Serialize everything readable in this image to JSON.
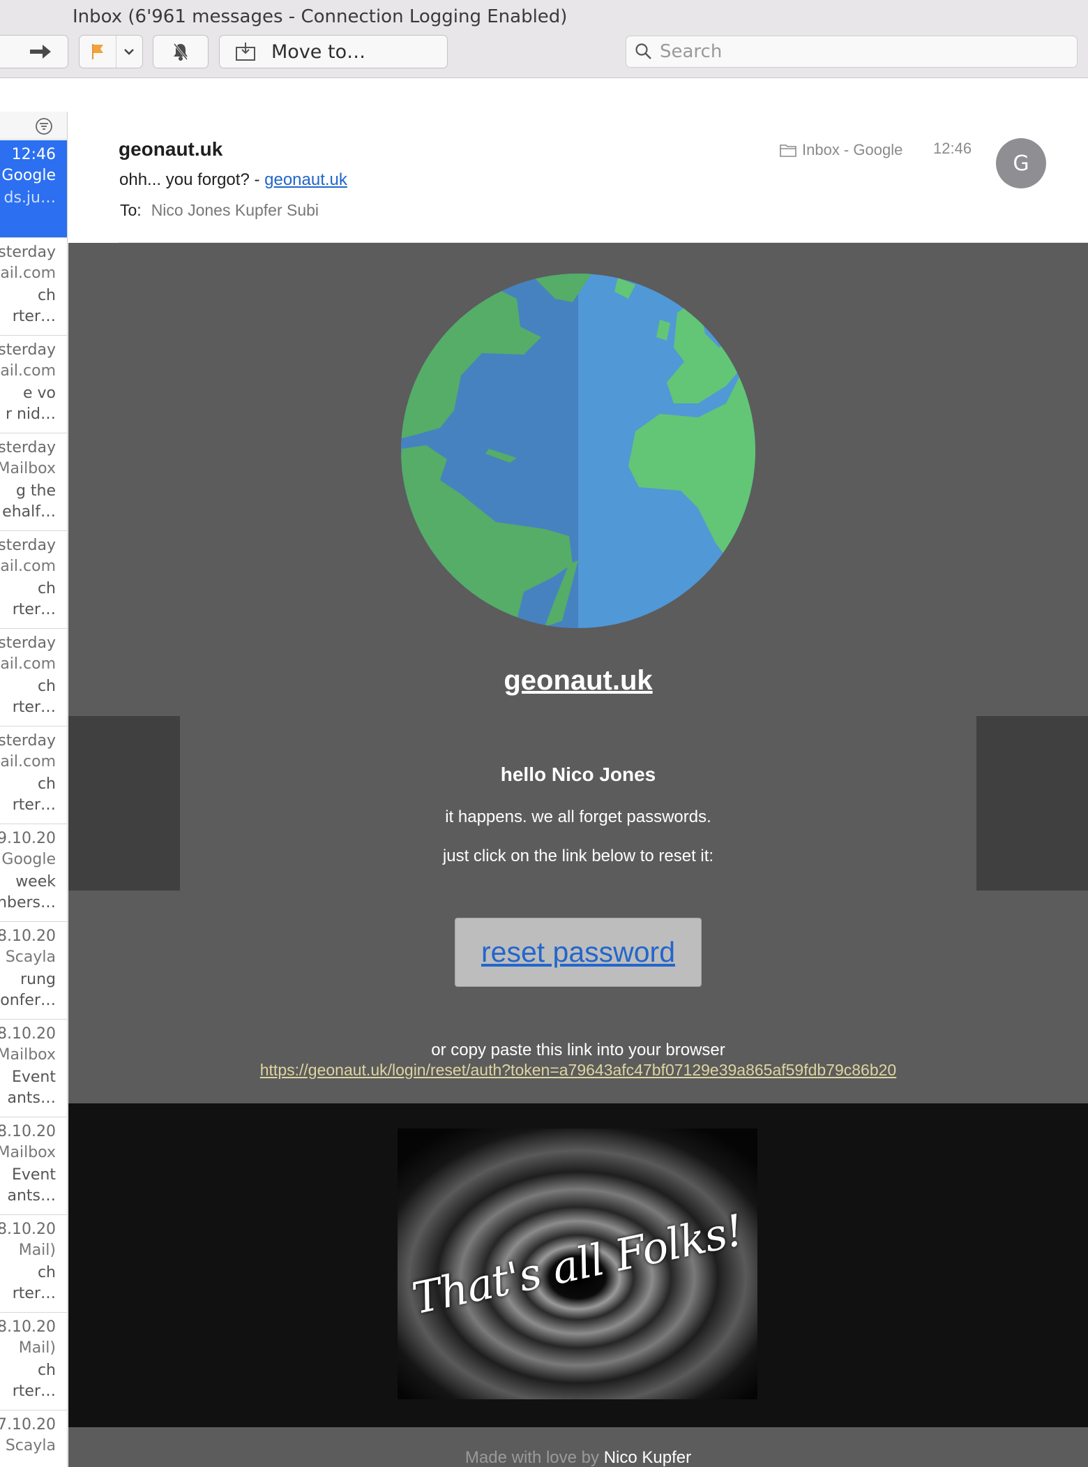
{
  "window": {
    "title": "Inbox (6'961 messages - Connection Logging Enabled)"
  },
  "toolbar": {
    "move_label": "Move to…"
  },
  "search": {
    "placeholder": "Search"
  },
  "message_list": {
    "items": [
      {
        "l1": "12:46",
        "l2": "Google",
        "l3": "ds.ju…",
        "l4": "",
        "selected": true
      },
      {
        "l1": "sterday",
        "l2": "ail.com",
        "l3": "ch",
        "l4": "rter…"
      },
      {
        "l1": "sterday",
        "l2": "ail.com",
        "l3": "e vo",
        "l4": "r nid…"
      },
      {
        "l1": "sterday",
        "l2": "Mailbox",
        "l3": "g the",
        "l4": "ehalf…"
      },
      {
        "l1": "sterday",
        "l2": "ail.com",
        "l3": "ch",
        "l4": "rter…"
      },
      {
        "l1": "sterday",
        "l2": "ail.com",
        "l3": "ch",
        "l4": "rter…"
      },
      {
        "l1": "sterday",
        "l2": "ail.com",
        "l3": "ch",
        "l4": "rter…"
      },
      {
        "l1": "9.10.20",
        "l2": "Google",
        "l3": "week",
        "l4": "nbers…"
      },
      {
        "l1": "8.10.20",
        "l2": "- Scayla",
        "l3": "rung",
        "l4": "onfer…"
      },
      {
        "l1": "8.10.20",
        "l2": "Mailbox",
        "l3": "Event",
        "l4": "ants…"
      },
      {
        "l1": "8.10.20",
        "l2": "Mailbox",
        "l3": "Event",
        "l4": "ants…"
      },
      {
        "l1": "8.10.20",
        "l2": "Mail)",
        "l3": "ch",
        "l4": "rter…"
      },
      {
        "l1": "8.10.20",
        "l2": "Mail)",
        "l3": "ch",
        "l4": "rter…"
      },
      {
        "l1": "7.10.20",
        "l2": "- Scayla",
        "l3": "",
        "l4": ""
      }
    ]
  },
  "message": {
    "from": "geonaut.uk",
    "subject_prefix": "ohh... you forgot? - ",
    "subject_link": "geonaut.uk",
    "to_label": "To:",
    "to_value": "Nico Jones Kupfer Subi",
    "mailbox": "Inbox - Google",
    "time": "12:46",
    "avatar_letter": "G"
  },
  "body": {
    "brand": "geonaut.uk",
    "greeting": "hello Nico Jones",
    "line1": "it happens. we all forget passwords.",
    "line2": "just click on the link below to reset it:",
    "button": "reset password",
    "copy_text": "or copy paste this link into your browser",
    "url": "https://geonaut.uk/login/reset/auth?token=a79643afc47bf07129e39a865af59fdb79c86b20",
    "folks_image_text": "That's all Folks!",
    "footer_prefix": "Made with love by ",
    "footer_author": "Nico Kupfer"
  },
  "colors": {
    "selection_blue": "#2c6ff0",
    "link_blue": "#2166c9",
    "body_background": "#5c5c5c",
    "url_color": "#ddd5a0",
    "globe_ocean": "#5198d6",
    "globe_land": "#62c676"
  },
  "icons": [
    "forward-arrow-icon",
    "flag-icon",
    "chevron-down-icon",
    "bell-slash-icon",
    "move-to-folder-icon",
    "search-icon",
    "filter-icon",
    "folder-icon"
  ]
}
